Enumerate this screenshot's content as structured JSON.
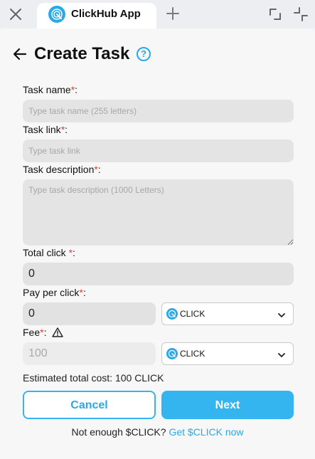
{
  "browser": {
    "tab_title": "ClickHub App",
    "icons": {
      "close": "close-icon",
      "add_tab": "plus-icon",
      "restore": "restore-window-icon",
      "shrink": "shrink-window-icon"
    }
  },
  "header": {
    "title": "Create Task",
    "back_icon": "arrow-left-icon",
    "help_icon": "question-circle-icon",
    "help_glyph": "?"
  },
  "form": {
    "task_name": {
      "label": "Task name",
      "required_mark": "*",
      "suffix": ":",
      "placeholder": "Type task name (255 letters)",
      "value": ""
    },
    "task_link": {
      "label": "Task link",
      "required_mark": "*",
      "suffix": ":",
      "placeholder": "Type task link",
      "value": ""
    },
    "task_description": {
      "label": "Task description",
      "required_mark": "*",
      "suffix": ":",
      "placeholder": "Type task description (1000 Letters)",
      "value": ""
    },
    "total_click": {
      "label": "Total click ",
      "required_mark": "*",
      "suffix": ":",
      "value": "0"
    },
    "pay_per_click": {
      "label": "Pay per click",
      "required_mark": "*",
      "suffix": ":",
      "value": "0",
      "currency": "CLICK"
    },
    "fee": {
      "label": "Fee",
      "required_mark": "*",
      "suffix": ":",
      "value": "100",
      "currency": "CLICK",
      "warning_icon": "warning-triangle-icon"
    }
  },
  "summary": {
    "estimated_total_cost": "Estimated total cost: 100 CLICK"
  },
  "actions": {
    "cancel_label": "Cancel",
    "next_label": "Next"
  },
  "footer": {
    "text": "Not enough $CLICK? ",
    "link": "Get $CLICK now"
  },
  "colors": {
    "accent": "#35b5f0",
    "required": "#e53935"
  }
}
